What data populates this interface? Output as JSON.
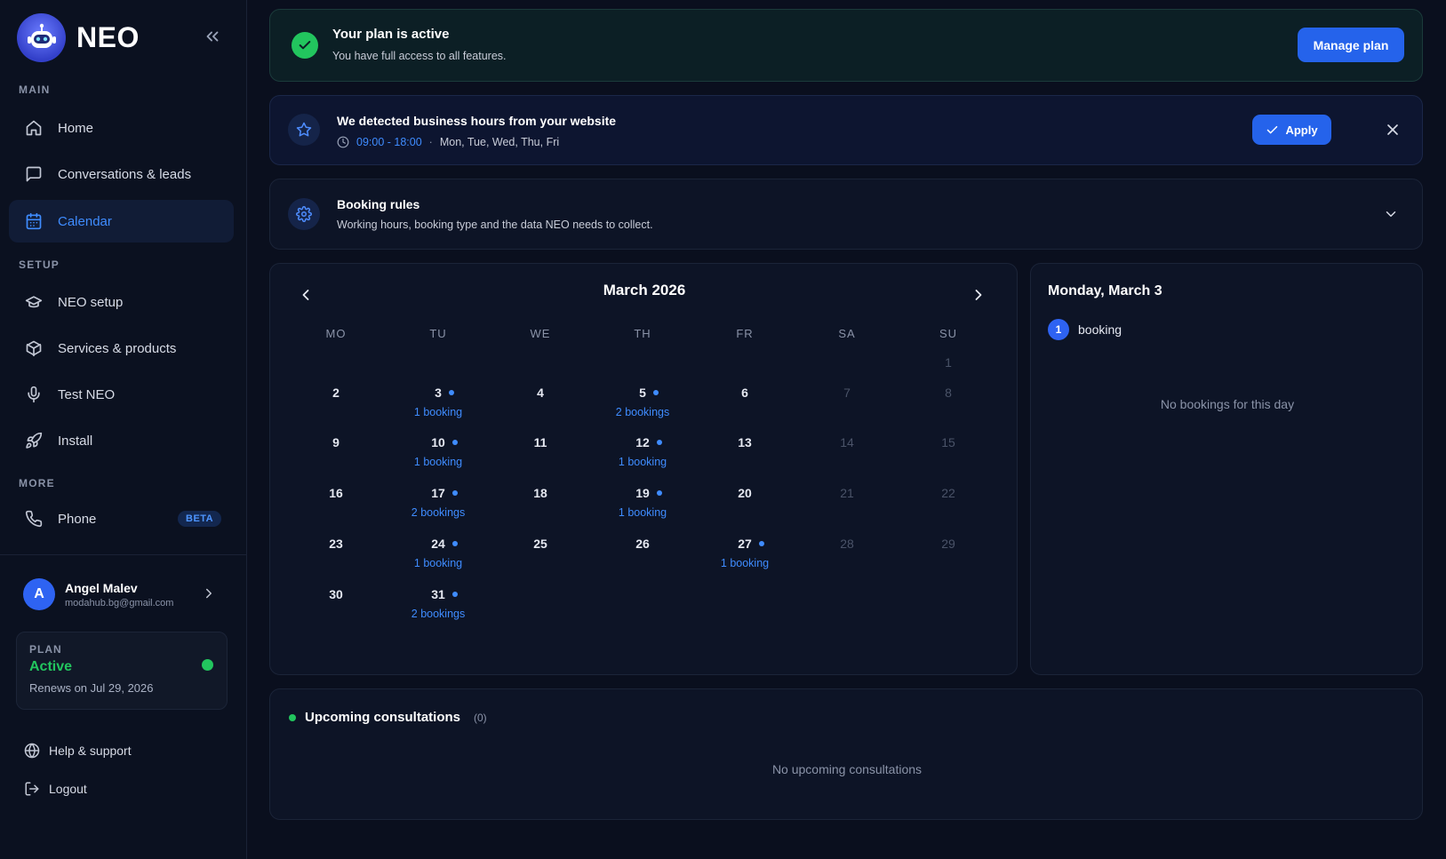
{
  "sidebar": {
    "brand": "NEO",
    "sections": {
      "main": "MAIN",
      "setup": "SETUP",
      "more": "MORE"
    },
    "items": {
      "home": "Home",
      "conversations": "Conversations & leads",
      "calendar": "Calendar",
      "neo_setup": "NEO setup",
      "services": "Services & products",
      "test": "Test NEO",
      "install": "Install",
      "phone": "Phone"
    },
    "phone_badge": "BETA",
    "user": {
      "initial": "A",
      "name": "Angel Malev",
      "email": "modahub.bg@gmail.com"
    },
    "plan": {
      "label": "PLAN",
      "status": "Active",
      "renews": "Renews on Jul 29, 2026"
    },
    "help": "Help & support",
    "logout": "Logout"
  },
  "plan_banner": {
    "title": "Your plan is active",
    "subtitle": "You have full access to all features.",
    "button": "Manage plan"
  },
  "hours": {
    "title": "We detected business hours from your website",
    "time": "09:00 - 18:00",
    "separator": "·",
    "days": "Mon, Tue, Wed, Thu, Fri",
    "apply": "Apply"
  },
  "rules": {
    "title": "Booking rules",
    "subtitle": "Working hours, booking type and the data NEO needs to collect."
  },
  "calendar": {
    "title": "March 2026",
    "weekdays": [
      "MO",
      "TU",
      "WE",
      "TH",
      "FR",
      "SA",
      "SU"
    ],
    "rows": [
      [
        null,
        null,
        null,
        null,
        null,
        null,
        {
          "n": "1",
          "m": true
        }
      ],
      [
        {
          "n": "2"
        },
        {
          "n": "3",
          "c": "1 booking"
        },
        {
          "n": "4"
        },
        {
          "n": "5",
          "c": "2 bookings"
        },
        {
          "n": "6"
        },
        {
          "n": "7",
          "m": true
        },
        {
          "n": "8",
          "m": true
        }
      ],
      [
        {
          "n": "9"
        },
        {
          "n": "10",
          "c": "1 booking"
        },
        {
          "n": "11"
        },
        {
          "n": "12",
          "c": "1 booking"
        },
        {
          "n": "13"
        },
        {
          "n": "14",
          "m": true
        },
        {
          "n": "15",
          "m": true
        }
      ],
      [
        {
          "n": "16"
        },
        {
          "n": "17",
          "c": "2 bookings"
        },
        {
          "n": "18"
        },
        {
          "n": "19",
          "c": "1 booking"
        },
        {
          "n": "20"
        },
        {
          "n": "21",
          "m": true
        },
        {
          "n": "22",
          "m": true
        }
      ],
      [
        {
          "n": "23"
        },
        {
          "n": "24",
          "c": "1 booking"
        },
        {
          "n": "25"
        },
        {
          "n": "26"
        },
        {
          "n": "27",
          "c": "1 booking"
        },
        {
          "n": "28",
          "m": true
        },
        {
          "n": "29",
          "m": true
        }
      ],
      [
        {
          "n": "30"
        },
        {
          "n": "31",
          "c": "2 bookings"
        },
        null,
        null,
        null,
        null,
        null
      ]
    ]
  },
  "detail": {
    "title": "Monday, March 3",
    "count": "1",
    "count_label": "booking",
    "empty": "No bookings for this day"
  },
  "upcoming": {
    "title": "Upcoming consultations",
    "count": "(0)",
    "empty": "No upcoming consultations"
  },
  "colors": {
    "accent": "#2563eb",
    "success": "#22c55e",
    "background": "#0a0f1e"
  }
}
